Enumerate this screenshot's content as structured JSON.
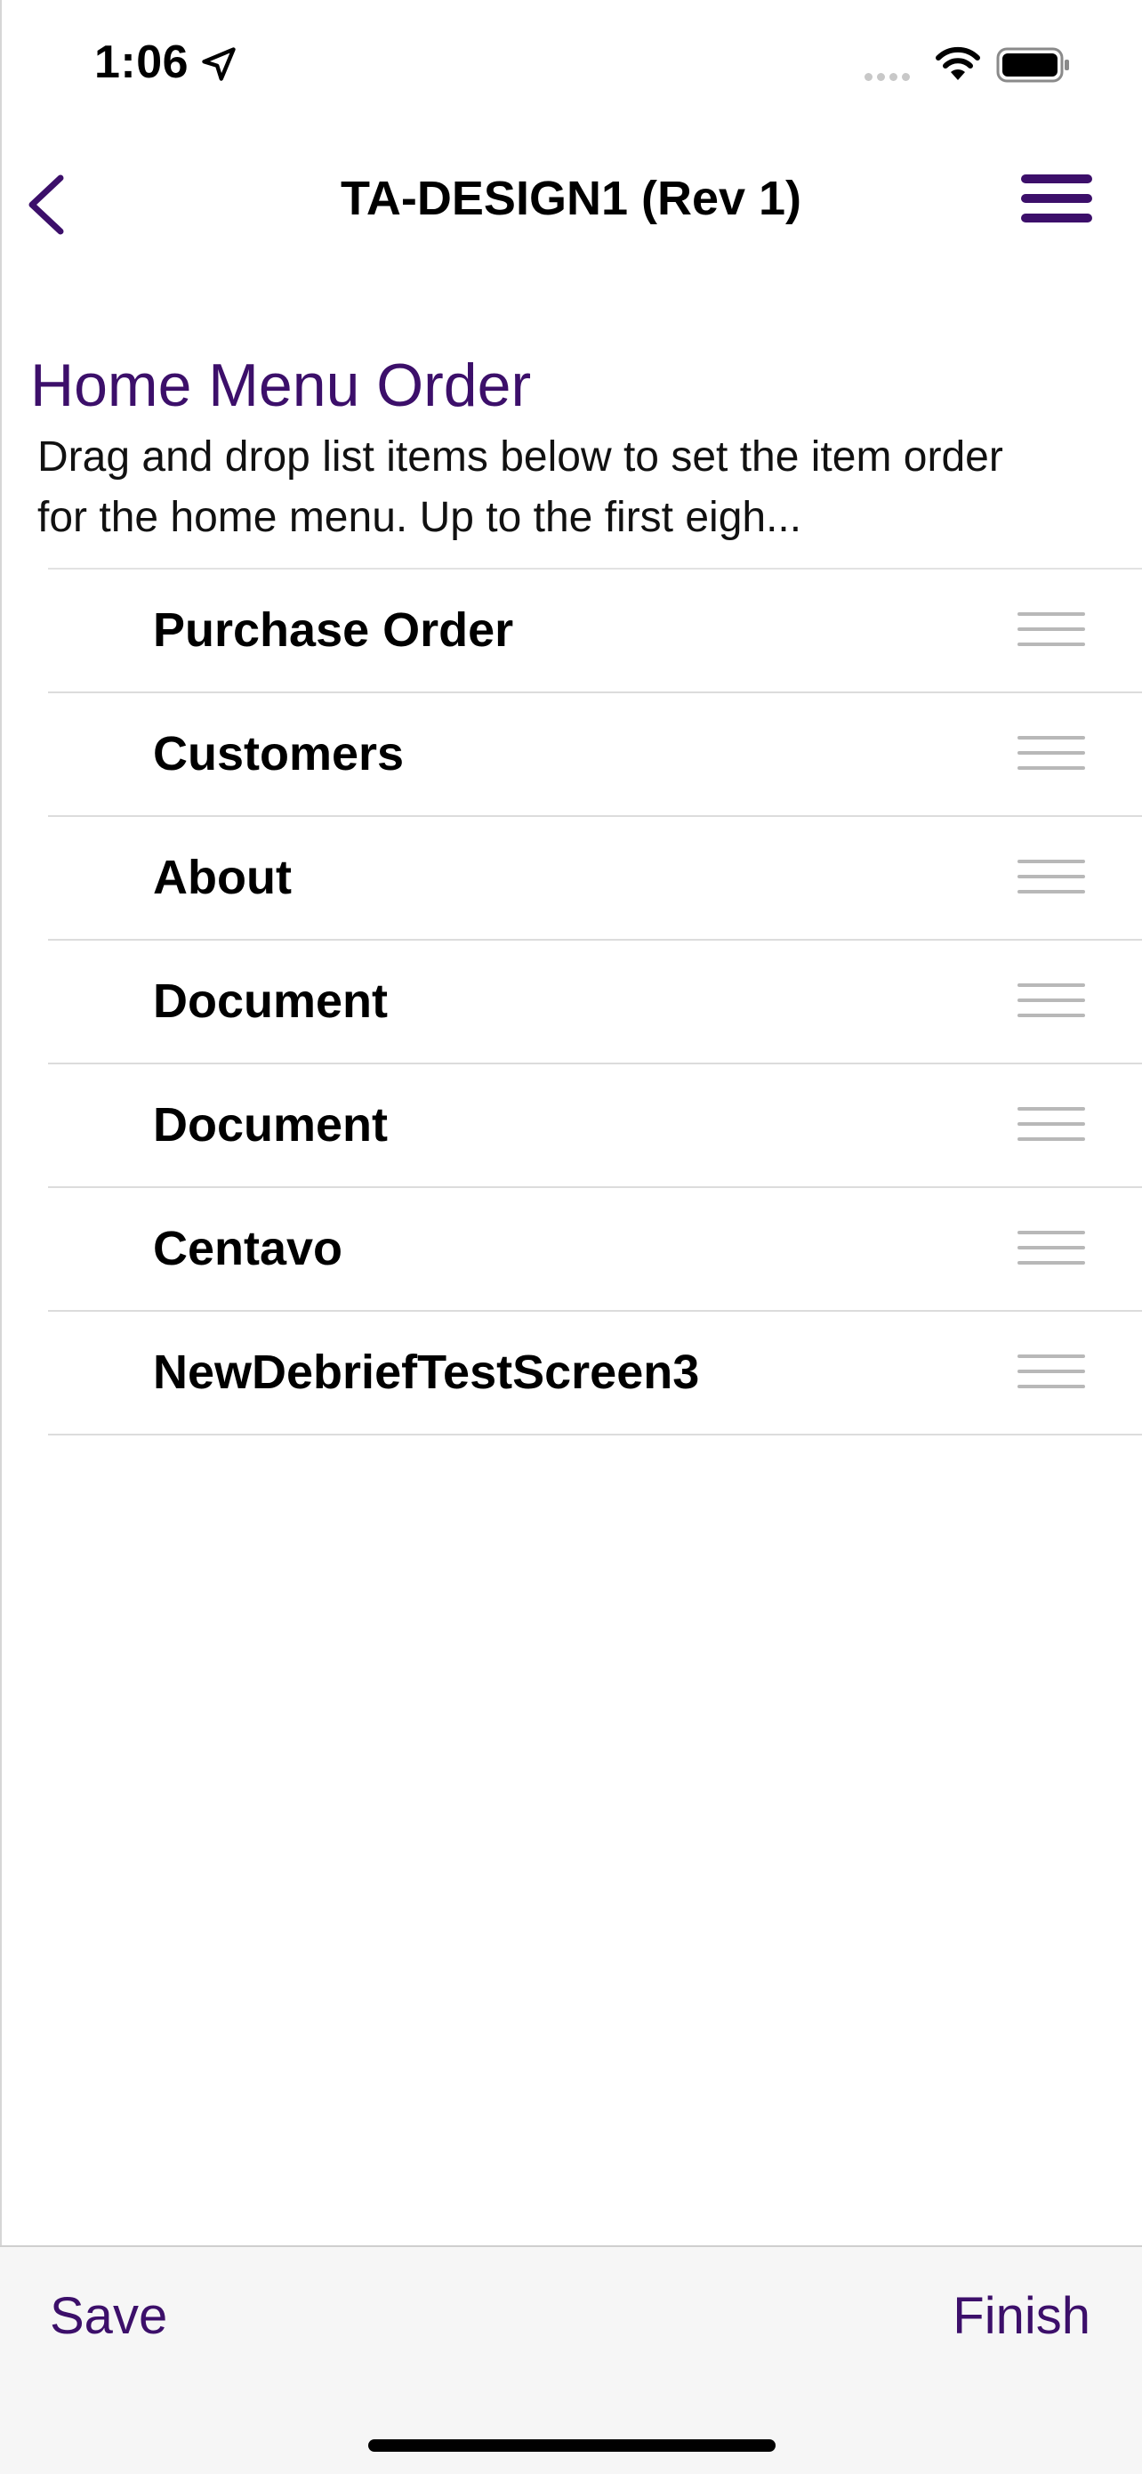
{
  "status_bar": {
    "time": "1:06",
    "icons": [
      "location-arrow-icon",
      "cellular-signal-icon",
      "wifi-icon",
      "battery-icon"
    ]
  },
  "nav": {
    "title": "TA-DESIGN1 (Rev 1)",
    "back_icon": "chevron-left-icon",
    "menu_icon": "hamburger-menu-icon"
  },
  "content": {
    "title": "Home Menu Order",
    "description": "Drag and drop list items below to set the item order for the home menu. Up to the first eigh..."
  },
  "list": {
    "items": [
      {
        "label": "Purchase Order"
      },
      {
        "label": "Customers"
      },
      {
        "label": "About"
      },
      {
        "label": "Document"
      },
      {
        "label": "Document"
      },
      {
        "label": "Centavo"
      },
      {
        "label": "NewDebriefTestScreen3"
      }
    ]
  },
  "toolbar": {
    "save_label": "Save",
    "finish_label": "Finish"
  },
  "colors": {
    "accent": "#3c0f6a",
    "divider": "#dcdcdc",
    "toolbar_bg": "#f6f6f6"
  }
}
